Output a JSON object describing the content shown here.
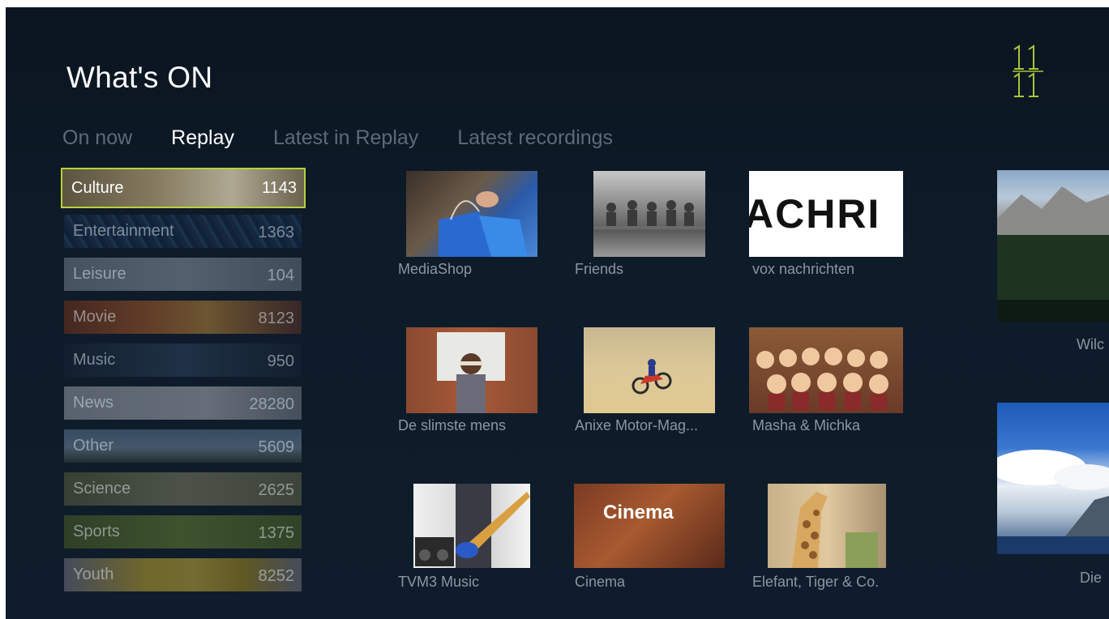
{
  "header": {
    "title": "What's ON"
  },
  "tabs": [
    {
      "label": "On now"
    },
    {
      "label": "Replay"
    },
    {
      "label": "Latest in Replay"
    },
    {
      "label": "Latest recordings"
    }
  ],
  "categories": [
    {
      "label": "Culture",
      "count": "1143"
    },
    {
      "label": "Entertainment",
      "count": "1363"
    },
    {
      "label": "Leisure",
      "count": "104"
    },
    {
      "label": "Movie",
      "count": "8123"
    },
    {
      "label": "Music",
      "count": "950"
    },
    {
      "label": "News",
      "count": "28280"
    },
    {
      "label": "Other",
      "count": "5609"
    },
    {
      "label": "Science",
      "count": "2625"
    },
    {
      "label": "Sports",
      "count": "1375"
    },
    {
      "label": "Youth",
      "count": "8252"
    }
  ],
  "programs": [
    {
      "title": "MediaShop"
    },
    {
      "title": "Friends"
    },
    {
      "title": "vox nachrichten",
      "thumb_text": "ACHRI"
    },
    {
      "title": "De slimste mens"
    },
    {
      "title": "Anixe Motor-Mag..."
    },
    {
      "title": "Masha & Michka"
    },
    {
      "title": "TVM3 Music"
    },
    {
      "title": "Cinema",
      "thumb_text": "Cinema"
    },
    {
      "title": "Elefant, Tiger & Co."
    }
  ],
  "side_programs": [
    {
      "title": "Wilc"
    },
    {
      "title": "Die"
    }
  ],
  "colors": {
    "background": "#0e1b29",
    "focus": "#b6d23a",
    "logo": "#a9c43a",
    "inactive_text": "#5e6a78"
  }
}
